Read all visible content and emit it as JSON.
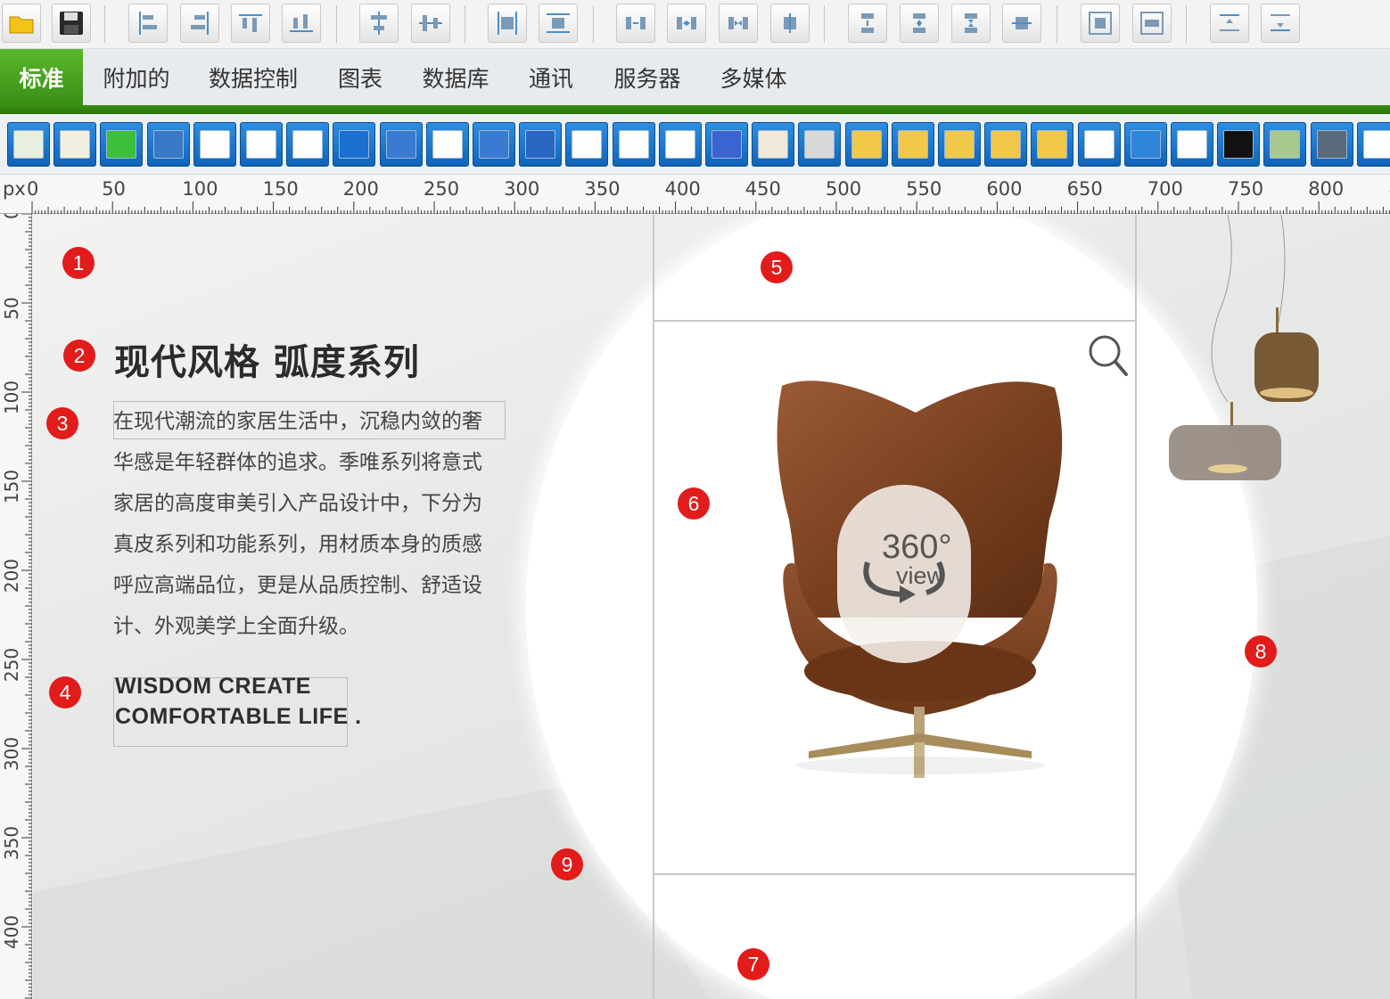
{
  "toolbar": {
    "buttons": [
      "open-folder",
      "save",
      "align-left",
      "align-right",
      "align-top",
      "align-bottom",
      "center-horizontal",
      "center-vertical",
      "same-width",
      "same-height",
      "space-horizontal-equal",
      "space-horizontal-increase",
      "space-horizontal-decrease",
      "space-horizontal-remove",
      "space-vertical-equal",
      "space-vertical-increase",
      "space-vertical-decrease",
      "space-vertical-remove",
      "center-in-parent-horizontal",
      "center-in-parent-vertical",
      "bring-to-front",
      "send-to-back"
    ]
  },
  "tabs": [
    {
      "label": "标准",
      "active": true
    },
    {
      "label": "附加的",
      "active": false
    },
    {
      "label": "数据控制",
      "active": false
    },
    {
      "label": "图表",
      "active": false
    },
    {
      "label": "数据库",
      "active": false
    },
    {
      "label": "通讯",
      "active": false
    },
    {
      "label": "服务器",
      "active": false
    },
    {
      "label": "多媒体",
      "active": false
    }
  ],
  "palette": {
    "components": [
      "checklist",
      "ok-button",
      "progress-bar",
      "radio-button",
      "checkbox",
      "list-box",
      "combo-list",
      "label",
      "edit",
      "dropdown",
      "spin-edit",
      "date-picker",
      "memo",
      "grid",
      "tab-control",
      "panel-list",
      "camera",
      "shape",
      "panel-yellow",
      "panel-yellow-2",
      "panel-yellow-3",
      "panel-yellow-4",
      "panel-yellow-5",
      "panel-white",
      "bevel",
      "string-grid",
      "draw-grid",
      "image-list",
      "image",
      "table"
    ]
  },
  "ruler": {
    "unit": "px",
    "h_ticks": [
      "0",
      "50",
      "100",
      "150",
      "200",
      "250",
      "300",
      "350",
      "400",
      "450",
      "500",
      "550",
      "600",
      "650",
      "700",
      "750",
      "800",
      "8"
    ],
    "v_ticks": [
      "0",
      "50",
      "100",
      "150",
      "200",
      "250",
      "300",
      "350",
      "400"
    ]
  },
  "canvas": {
    "badges": [
      "1",
      "2",
      "3",
      "4",
      "5",
      "6",
      "7",
      "8",
      "9"
    ],
    "title": "现代风格 弧度系列",
    "paragraph_lines": [
      "在现代潮流的家居生活中，沉稳内敛的奢",
      "华感是年轻群体的追求。季唯系列将意式",
      "家居的高度审美引入产品设计中，下分为",
      "真皮系列和功能系列，用材质本身的质感",
      "呼应高端品位，更是从品质控制、舒适设",
      "计、外观美学上全面升级。"
    ],
    "slogan_line1": "WISDOM CREATE",
    "slogan_line2": "COMFORTABLE LIFE .",
    "view_number": "360°",
    "view_word": "view"
  },
  "colors": {
    "accent_green": "#3a8f14",
    "badge_red": "#e21b1b",
    "palette_blue": "#1a78cf"
  }
}
